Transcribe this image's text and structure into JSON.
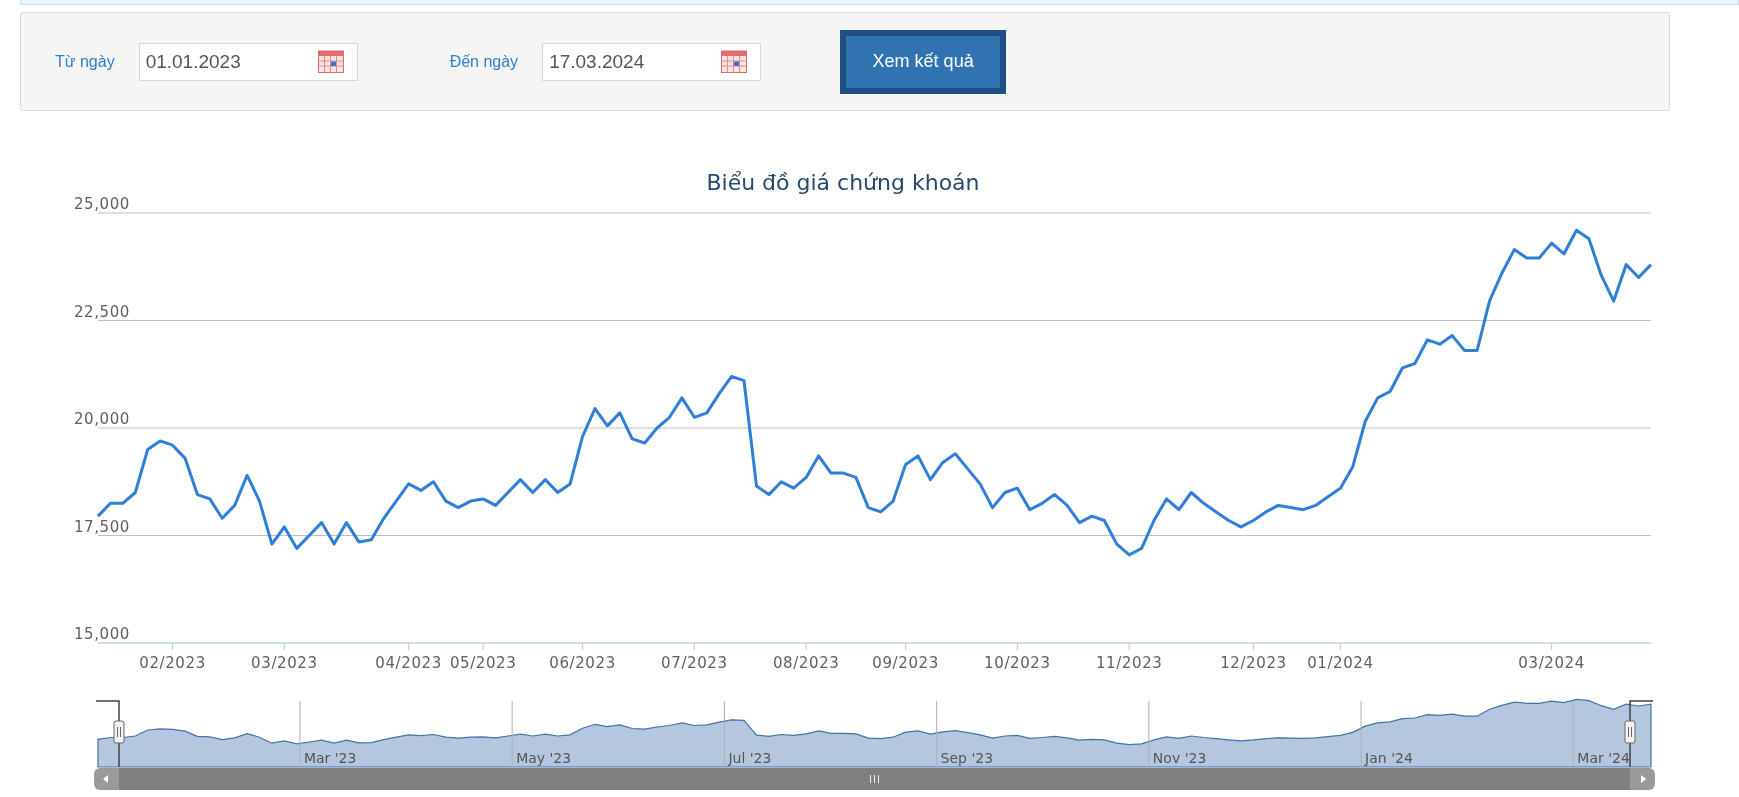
{
  "filter": {
    "from_label": "Từ ngày",
    "from_value": "01.01.2023",
    "to_label": "Đến ngày",
    "to_value": "17.03.2024",
    "submit": "Xem kết quả"
  },
  "chart": {
    "chart_data": {
      "type": "line",
      "title": "Biểu đồ giá chứng khoán",
      "categories": [
        null,
        null,
        null,
        null,
        null,
        null,
        "02/2023",
        null,
        null,
        null,
        null,
        null,
        null,
        null,
        null,
        "03/2023",
        null,
        null,
        null,
        null,
        null,
        null,
        null,
        null,
        null,
        "04/2023",
        null,
        null,
        null,
        null,
        null,
        "05/2023",
        null,
        null,
        null,
        null,
        null,
        null,
        null,
        "06/2023",
        null,
        null,
        null,
        null,
        null,
        null,
        null,
        null,
        "07/2023",
        null,
        null,
        null,
        null,
        null,
        null,
        null,
        null,
        "08/2023",
        null,
        null,
        null,
        null,
        null,
        null,
        null,
        "09/2023",
        null,
        null,
        null,
        null,
        null,
        null,
        null,
        null,
        "10/2023",
        null,
        null,
        null,
        null,
        null,
        null,
        null,
        null,
        "11/2023",
        null,
        null,
        null,
        null,
        null,
        null,
        null,
        null,
        null,
        "12/2023",
        null,
        null,
        null,
        null,
        null,
        null,
        "01/2024",
        null,
        null,
        null,
        null,
        null,
        null,
        null,
        null,
        null,
        null,
        null,
        null,
        null,
        null,
        null,
        null,
        "03/2024",
        null,
        null,
        null,
        null,
        null,
        null,
        null,
        null
      ],
      "series": [
        {
          "color": "#2f7ed8",
          "values": [
            17950,
            18250,
            18250,
            18500,
            19500,
            19700,
            19600,
            19300,
            18450,
            18350,
            17900,
            18200,
            18900,
            18300,
            17300,
            17700,
            17200,
            17500,
            17800,
            17300,
            17800,
            17350,
            17400,
            17900,
            18300,
            18700,
            18550,
            18750,
            18300,
            18150,
            18300,
            18350,
            18200,
            18500,
            18800,
            18500,
            18800,
            18500,
            18700,
            19800,
            20450,
            20050,
            20350,
            19750,
            19650,
            20000,
            20250,
            20700,
            20250,
            20350,
            20800,
            21200,
            21100,
            18650,
            18450,
            18750,
            18600,
            18850,
            19350,
            18950,
            18950,
            18850,
            18150,
            18050,
            18300,
            19150,
            19350,
            18800,
            19200,
            19400,
            19050,
            18700,
            18150,
            18500,
            18600,
            18100,
            18250,
            18450,
            18200,
            17800,
            17950,
            17850,
            17300,
            17050,
            17200,
            17850,
            18350,
            18100,
            18500,
            18250,
            18050,
            17850,
            17700,
            17850,
            18050,
            18200,
            18150,
            18100,
            18200,
            18400,
            18600,
            19100,
            20150,
            20700,
            20850,
            21400,
            21500,
            22050,
            21950,
            22150,
            21800,
            21800,
            22950,
            23600,
            24150,
            23950,
            23950,
            24300,
            24050,
            24600,
            24400,
            23550,
            22950,
            23800,
            23500,
            23800
          ]
        }
      ],
      "ylim": [
        15000,
        25000
      ],
      "grid": true,
      "yticks": [
        {
          "value": 15000,
          "label": "15,000"
        },
        {
          "value": 17500,
          "label": "17,500"
        },
        {
          "value": 20000,
          "label": "20,000"
        },
        {
          "value": 22500,
          "label": "22,500"
        },
        {
          "value": 25000,
          "label": "25,000"
        }
      ]
    }
  },
  "navigator": {
    "labels": [
      "Mar '23",
      "May '23",
      "Jul '23",
      "Sep '23",
      "Nov '23",
      "Jan '24",
      "Mar '24"
    ]
  }
}
